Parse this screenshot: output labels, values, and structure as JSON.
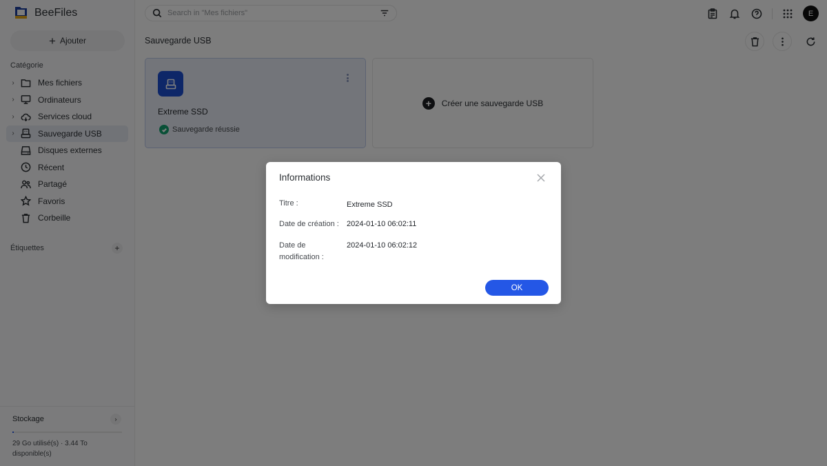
{
  "app": {
    "name": "BeeFiles"
  },
  "sidebar": {
    "add_label": "Ajouter",
    "category_label": "Catégorie",
    "items": [
      {
        "label": "Mes fichiers",
        "icon": "folder-icon",
        "expandable": true,
        "active": false
      },
      {
        "label": "Ordinateurs",
        "icon": "monitor-icon",
        "expandable": true,
        "active": false
      },
      {
        "label": "Services cloud",
        "icon": "cloud-icon",
        "expandable": true,
        "active": false
      },
      {
        "label": "Sauvegarde USB",
        "icon": "usb-drive-icon",
        "expandable": true,
        "active": true
      },
      {
        "label": "Disques externes",
        "icon": "external-drive-icon",
        "expandable": false,
        "active": false
      },
      {
        "label": "Récent",
        "icon": "clock-icon",
        "expandable": false,
        "active": false
      },
      {
        "label": "Partagé",
        "icon": "users-icon",
        "expandable": false,
        "active": false
      },
      {
        "label": "Favoris",
        "icon": "star-icon",
        "expandable": false,
        "active": false
      },
      {
        "label": "Corbeille",
        "icon": "trash-icon",
        "expandable": false,
        "active": false
      }
    ],
    "tags_label": "Étiquettes",
    "storage": {
      "title": "Stockage",
      "used_fraction": 0.008,
      "text": "29 Go utilisé(s)  ·  3.44 To disponible(s)"
    }
  },
  "topbar": {
    "search_placeholder": "Search in \"Mes fichiers\"",
    "search_value": "",
    "avatar_initial": "E"
  },
  "content": {
    "title": "Sauvegarde USB",
    "cards": [
      {
        "name": "Extreme SSD",
        "status": "Sauvegarde réussie",
        "status_color": "#12a06f"
      }
    ],
    "create_label": "Créer une sauvegarde USB"
  },
  "dialog": {
    "title": "Informations",
    "rows": [
      {
        "label": "Titre :",
        "value": "Extreme SSD"
      },
      {
        "label": "Date de création :",
        "value": "2024-01-10 06:02:11"
      },
      {
        "label": "Date de modification :",
        "value": "2024-01-10 06:02:12"
      }
    ],
    "ok_label": "OK"
  },
  "colors": {
    "accent": "#2457e6",
    "card_icon": "#1c4fd0",
    "success": "#12a06f"
  }
}
